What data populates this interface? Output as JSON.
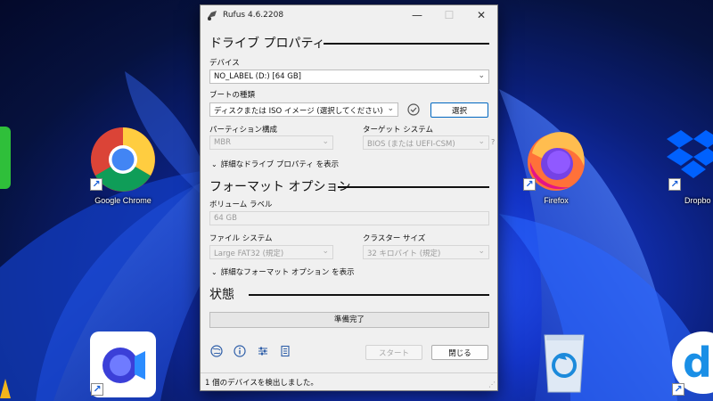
{
  "desktop": {
    "icons": {
      "chrome": "Google Chrome",
      "firefox": "Firefox",
      "dropbox": "Dropbo"
    }
  },
  "window": {
    "title": "Rufus 4.6.2208",
    "drive_section": "ドライブ プロパティ",
    "device_label": "デバイス",
    "device_value": "NO_LABEL (D:) [64 GB]",
    "boot_label": "ブートの種類",
    "boot_value": "ディスクまたは ISO イメージ (選択してください)",
    "select_button": "選択",
    "partition_label": "パーティション構成",
    "partition_value": "MBR",
    "target_label": "ターゲット システム",
    "target_value": "BIOS (または UEFI-CSM)",
    "advanced_drive": "詳細なドライブ プロパティ を表示",
    "format_section": "フォーマット オプション",
    "volume_label": "ボリューム ラベル",
    "volume_value": "64 GB",
    "fs_label": "ファイル システム",
    "fs_value": "Large FAT32 (規定)",
    "cluster_label": "クラスター サイズ",
    "cluster_value": "32 キロバイト (規定)",
    "advanced_format": "詳細なフォーマット オプション を表示",
    "status_section": "状態",
    "progress_text": "準備完了",
    "start_button": "スタート",
    "close_button": "閉じる",
    "status_text": "1 個のデバイスを検出しました。",
    "question_mark": "?"
  }
}
